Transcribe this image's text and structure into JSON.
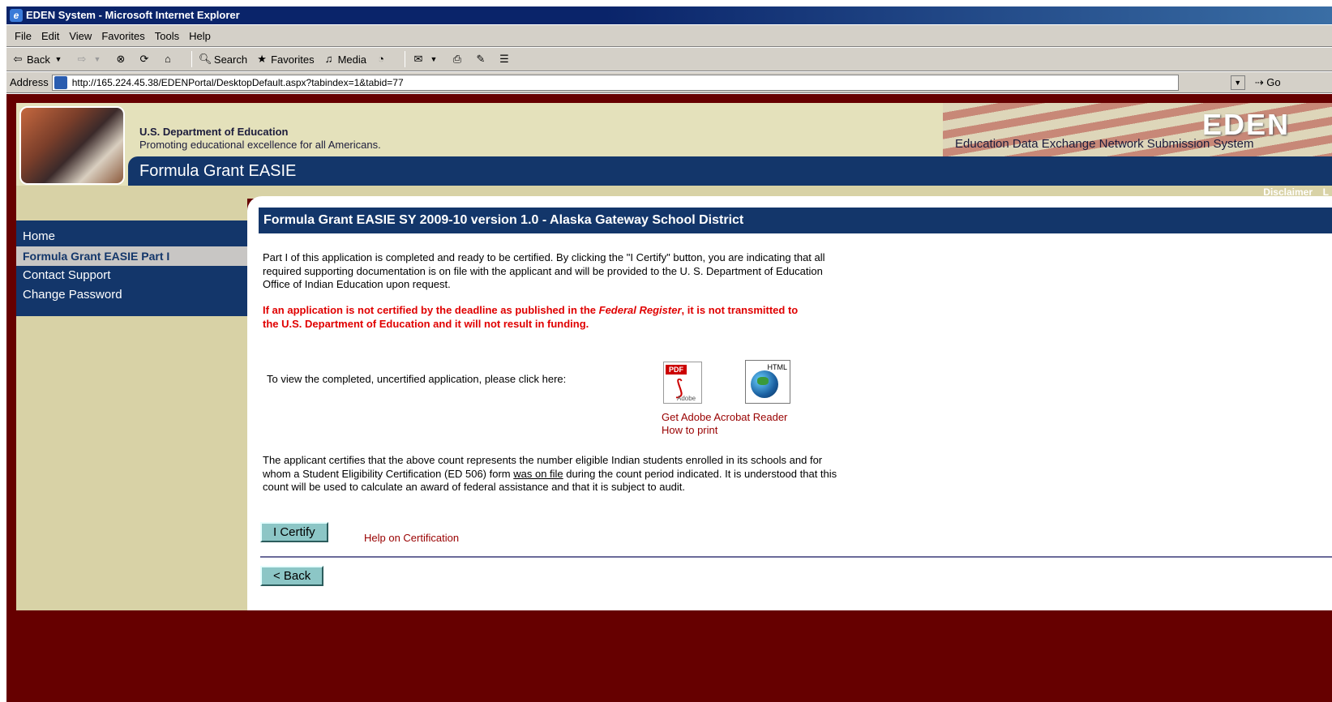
{
  "window": {
    "title": "EDEN System - Microsoft Internet Explorer"
  },
  "menu": [
    "File",
    "Edit",
    "View",
    "Favorites",
    "Tools",
    "Help"
  ],
  "toolbar": {
    "back": "Back",
    "search": "Search",
    "favorites": "Favorites",
    "media": "Media"
  },
  "address": {
    "label": "Address",
    "url": "http://165.224.45.38/EDENPortal/DesktopDefault.aspx?tabindex=1&tabid=77",
    "go": "Go"
  },
  "banner": {
    "dept_name": "U.S. Department of Education",
    "dept_tagline": "Promoting educational excellence for all Americans.",
    "app_title": "Formula Grant EASIE",
    "logo_text": "EDEN",
    "logo_subtitle": "Education Data Exchange Network Submission System",
    "disclaimer": "Disclaimer",
    "util_extra": "L"
  },
  "sidebar": {
    "items": [
      {
        "label": "Home",
        "active": false
      },
      {
        "label": "Formula Grant EASIE Part I",
        "active": true
      },
      {
        "label": "Contact Support",
        "active": false
      },
      {
        "label": "Change Password",
        "active": false
      }
    ]
  },
  "main": {
    "heading": "Formula Grant EASIE SY 2009-10 version 1.0 - Alaska Gateway School District",
    "intro": "Part I of this application is completed and ready to be certified. By clicking the \"I Certify\" button, you are indicating that all required supporting documentation is on file with the applicant and will be provided to the U. S. Department of Education Office of Indian Education upon request.",
    "warning_part1": "If an application is not certified by the deadline as published in the ",
    "warning_italic": "Federal Register",
    "warning_part2": ", it is not transmitted to the U.S. Department of Education and it will not result in funding.",
    "view_prompt": "To view the completed, uncertified application, please click here:",
    "pdf_label": "PDF",
    "pdf_brand": "Adobe",
    "html_label": "HTML",
    "get_reader": "Get Adobe Acrobat Reader",
    "how_to_print": "How to print",
    "cert_part1": "The applicant certifies that the above count represents the number eligible Indian students enrolled in its schools and for whom a Student Eligibility Certification (ED 506) form ",
    "cert_link": "was on file",
    "cert_part2": " during the count period indicated. It is understood that this count will be used to calculate an award of federal assistance and that it is subject to audit.",
    "certify_button": "I Certify",
    "help_link": "Help on Certification",
    "back_button": "< Back"
  }
}
